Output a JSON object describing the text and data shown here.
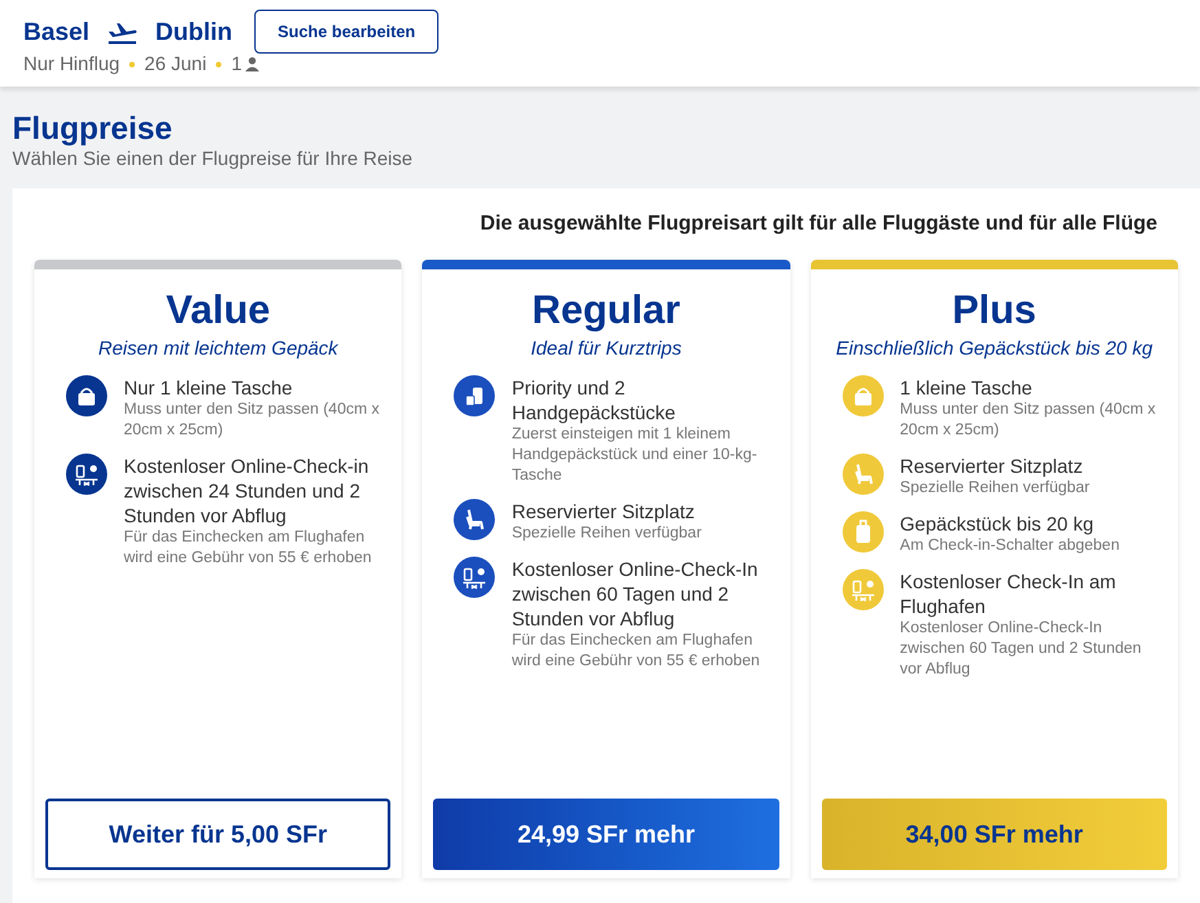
{
  "header": {
    "origin": "Basel",
    "destination": "Dublin",
    "edit_button": "Suche bearbeiten",
    "trip_type": "Nur Hinflug",
    "date": "26 Juni",
    "passengers": "1"
  },
  "page": {
    "title": "Flugpreise",
    "subtitle": "Wählen Sie einen der Flugpreise für Ihre Reise"
  },
  "note": "Die ausgewählte Flugpreisart gilt für alle Fluggäste und für alle Flüge",
  "fares": [
    {
      "kind": "value",
      "name": "Value",
      "tagline": "Reisen mit leichtem Gepäck",
      "features": [
        {
          "kind": "bag",
          "title": "Nur 1 kleine Tasche",
          "detail": "Muss unter den Sitz passen (40cm x 20cm x 25cm)"
        },
        {
          "kind": "checkin",
          "title": "Kostenloser Online-Check-in zwischen 24 Stunden und 2 Stunden vor Abflug",
          "detail": "Für das Einchecken am Flughafen wird eine Gebühr von 55 € erhoben"
        }
      ],
      "button": "Weiter für 5,00 SFr"
    },
    {
      "kind": "regular",
      "name": "Regular",
      "tagline": "Ideal für Kurztrips",
      "features": [
        {
          "kind": "luggage",
          "title": "Priority und 2 Handgepäckstücke",
          "detail": "Zuerst einsteigen mit 1 kleinem Handgepäckstück und einer 10-kg-Tasche"
        },
        {
          "kind": "seat",
          "title": "Reservierter Sitzplatz",
          "detail": "Spezielle Reihen verfügbar"
        },
        {
          "kind": "checkin",
          "title": "Kostenloser Online-Check-In zwischen 60 Tagen und 2 Stunden vor Abflug",
          "detail": "Für das Einchecken am Flughafen wird eine Gebühr von 55 € erhoben"
        }
      ],
      "button": "24,99 SFr mehr"
    },
    {
      "kind": "plus",
      "name": "Plus",
      "tagline": "Einschließlich Gepäckstück bis 20 kg",
      "features": [
        {
          "kind": "bag",
          "title": "1 kleine Tasche",
          "detail": "Muss unter den Sitz passen (40cm x 20cm x 25cm)"
        },
        {
          "kind": "seat",
          "title": "Reservierter Sitzplatz",
          "detail": "Spezielle Reihen verfügbar"
        },
        {
          "kind": "suitcase",
          "title": "Gepäckstück bis 20 kg",
          "detail": "Am Check-in-Schalter abgeben"
        },
        {
          "kind": "checkin",
          "title": "Kostenloser Check-In am Flughafen",
          "detail": "Kostenloser Online-Check-In zwischen 60 Tagen und 2 Stunden vor Abflug"
        }
      ],
      "button": "34,00 SFr mehr"
    }
  ]
}
